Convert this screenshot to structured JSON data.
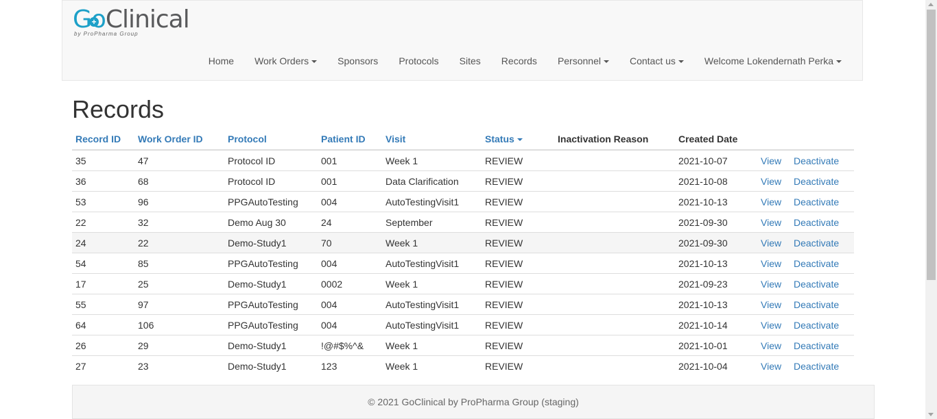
{
  "brand": {
    "name_part1": "Go",
    "name_part2": "Clinical",
    "subtitle": "by ProPharma Group"
  },
  "nav": {
    "items": [
      {
        "label": "Home",
        "dropdown": false
      },
      {
        "label": "Work Orders",
        "dropdown": true
      },
      {
        "label": "Sponsors",
        "dropdown": false
      },
      {
        "label": "Protocols",
        "dropdown": false
      },
      {
        "label": "Sites",
        "dropdown": false
      },
      {
        "label": "Records",
        "dropdown": false
      },
      {
        "label": "Personnel",
        "dropdown": true
      },
      {
        "label": "Contact us",
        "dropdown": true
      },
      {
        "label": "Welcome Lokendernath Perka",
        "dropdown": true
      }
    ]
  },
  "page": {
    "title": "Records"
  },
  "table": {
    "headers": {
      "record_id": "Record ID",
      "work_order_id": "Work Order ID",
      "protocol": "Protocol",
      "patient_id": "Patient ID",
      "visit": "Visit",
      "status": "Status",
      "inactivation_reason": "Inactivation Reason",
      "created_date": "Created Date"
    },
    "action_view": "View",
    "action_deactivate": "Deactivate",
    "rows": [
      {
        "record_id": "35",
        "work_order_id": "47",
        "protocol": "Protocol ID",
        "patient_id": "001",
        "visit": "Week 1",
        "status": "REVIEW",
        "inactivation_reason": "",
        "created_date": "2021-10-07"
      },
      {
        "record_id": "36",
        "work_order_id": "68",
        "protocol": "Protocol ID",
        "patient_id": "001",
        "visit": "Data Clarification",
        "status": "REVIEW",
        "inactivation_reason": "",
        "created_date": "2021-10-08"
      },
      {
        "record_id": "53",
        "work_order_id": "96",
        "protocol": "PPGAutoTesting",
        "patient_id": "004",
        "visit": "AutoTestingVisit1",
        "status": "REVIEW",
        "inactivation_reason": "",
        "created_date": "2021-10-13"
      },
      {
        "record_id": "22",
        "work_order_id": "32",
        "protocol": "Demo Aug 30",
        "patient_id": "24",
        "visit": "September",
        "status": "REVIEW",
        "inactivation_reason": "",
        "created_date": "2021-09-30"
      },
      {
        "record_id": "24",
        "work_order_id": "22",
        "protocol": "Demo-Study1",
        "patient_id": "70",
        "visit": "Week 1",
        "status": "REVIEW",
        "inactivation_reason": "",
        "created_date": "2021-09-30"
      },
      {
        "record_id": "54",
        "work_order_id": "85",
        "protocol": "PPGAutoTesting",
        "patient_id": "004",
        "visit": "AutoTestingVisit1",
        "status": "REVIEW",
        "inactivation_reason": "",
        "created_date": "2021-10-13"
      },
      {
        "record_id": "17",
        "work_order_id": "25",
        "protocol": "Demo-Study1",
        "patient_id": "0002",
        "visit": "Week 1",
        "status": "REVIEW",
        "inactivation_reason": "",
        "created_date": "2021-09-23"
      },
      {
        "record_id": "55",
        "work_order_id": "97",
        "protocol": "PPGAutoTesting",
        "patient_id": "004",
        "visit": "AutoTestingVisit1",
        "status": "REVIEW",
        "inactivation_reason": "",
        "created_date": "2021-10-13"
      },
      {
        "record_id": "64",
        "work_order_id": "106",
        "protocol": "PPGAutoTesting",
        "patient_id": "004",
        "visit": "AutoTestingVisit1",
        "status": "REVIEW",
        "inactivation_reason": "",
        "created_date": "2021-10-14"
      },
      {
        "record_id": "26",
        "work_order_id": "29",
        "protocol": "Demo-Study1",
        "patient_id": "!@#$%^&",
        "visit": "Week 1",
        "status": "REVIEW",
        "inactivation_reason": "",
        "created_date": "2021-10-01"
      },
      {
        "record_id": "27",
        "work_order_id": "23",
        "protocol": "Demo-Study1",
        "patient_id": "123",
        "visit": "Week 1",
        "status": "REVIEW",
        "inactivation_reason": "",
        "created_date": "2021-10-04"
      }
    ]
  },
  "footer": {
    "text": "© 2021 GoClinical by ProPharma Group (staging)"
  },
  "colors": {
    "link": "#337ab7",
    "brand_blue": "#1da0c8",
    "brand_gray": "#58595b",
    "navbar_bg": "#f8f8f8"
  }
}
